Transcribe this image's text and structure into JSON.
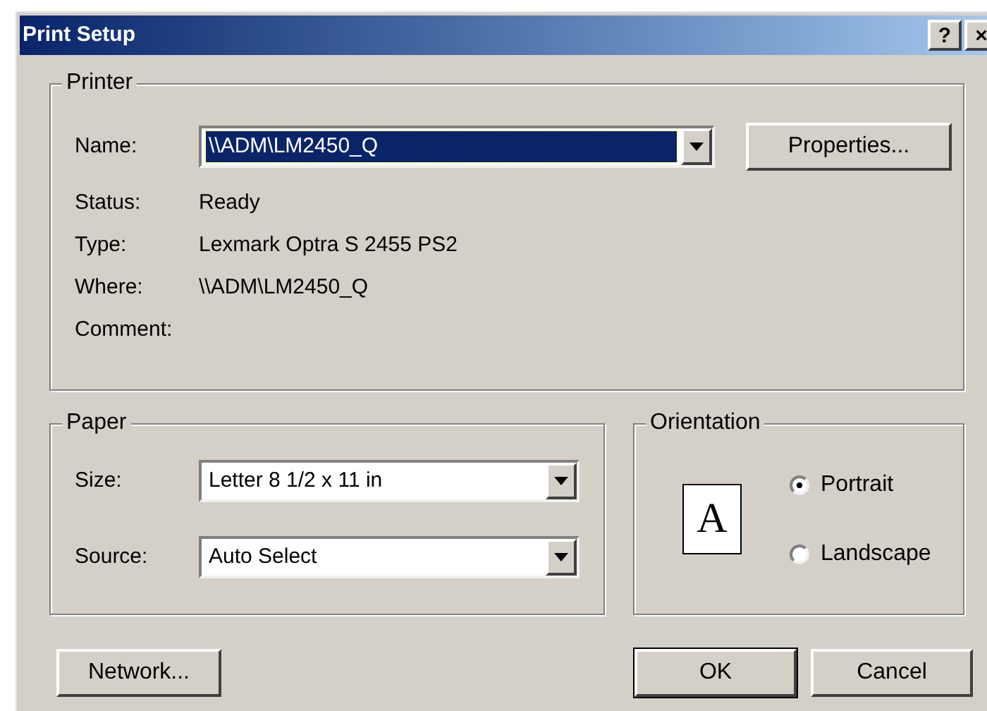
{
  "window": {
    "title": "Print Setup",
    "title_buttons": [
      "?",
      "×"
    ]
  },
  "printer": {
    "legend": "Printer",
    "name_label": "Name:",
    "name_value": "\\\\ADM\\LM2450_Q",
    "name_focused": true,
    "properties_button": "Properties...",
    "info": [
      {
        "label": "Status:",
        "value": "Ready"
      },
      {
        "label": "Type:",
        "value": "Lexmark Optra S 2455 PS2"
      },
      {
        "label": "Where:",
        "value": "\\\\ADM\\LM2450_Q"
      },
      {
        "label": "Comment:"
      }
    ]
  },
  "paper": {
    "legend": "Paper",
    "fields": [
      {
        "label": "Size:",
        "value": "Letter 8 1/2 x 11 in"
      },
      {
        "label": "Source:",
        "value": "Auto Select"
      }
    ]
  },
  "orientation": {
    "legend": "Orientation",
    "page_letter": "A",
    "options": [
      {
        "label": "Portrait",
        "selected": true
      },
      {
        "label": "Landscape",
        "selected": false
      }
    ]
  },
  "buttons": {
    "network": "Network...",
    "ok": "OK",
    "cancel": "Cancel"
  }
}
